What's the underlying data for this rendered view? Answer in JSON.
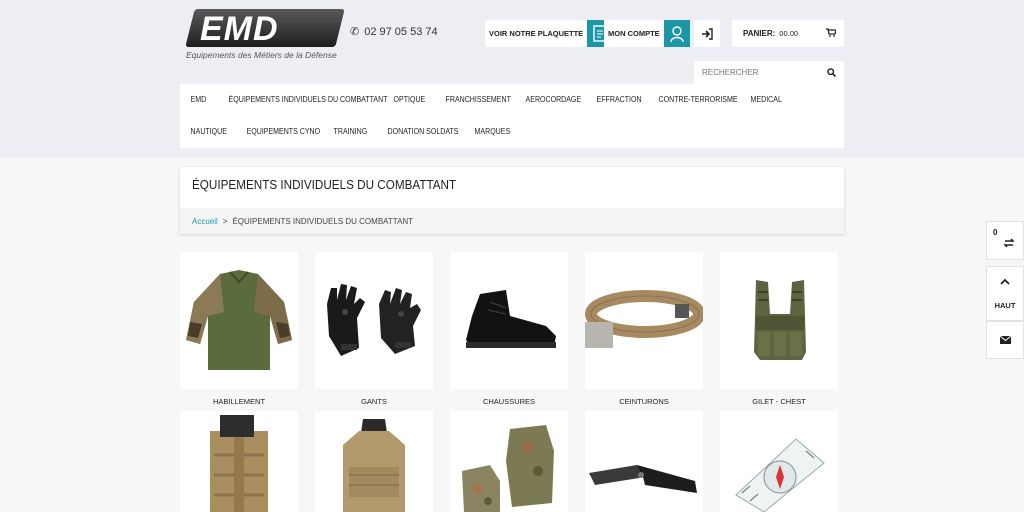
{
  "header": {
    "logo_text": "EMD",
    "tagline": "Equipements des Métiers de la Défense",
    "phone": "02 97 05 53 74",
    "plaquette_label": "VOIR NOTRE PLAQUETTE",
    "account_label": "MON COMPTE",
    "cart_label": "PANIER:",
    "cart_value": "00.00",
    "search_placeholder": "RECHERCHER"
  },
  "nav": {
    "row1": [
      "EMD",
      "ÉQUIPEMENTS INDIVIDUELS DU COMBATTANT",
      "OPTIQUE",
      "FRANCHISSEMENT",
      "AEROCORDAGE",
      "EFFRACTION",
      "CONTRE-TERRORISME",
      "MEDICAL"
    ],
    "row2": [
      "NAUTIQUE",
      "EQUIPEMENTS CYNO",
      "TRAINING",
      "DONATION SOLDATS",
      "MARQUES"
    ]
  },
  "page": {
    "title": "ÉQUIPEMENTS INDIVIDUELS DU COMBATTANT",
    "breadcrumb_home": "Accueil",
    "breadcrumb_sep": ">",
    "breadcrumb_current": "ÉQUIPEMENTS INDIVIDUELS DU COMBATTANT"
  },
  "categories": [
    "HABILLEMENT",
    "GANTS",
    "CHAUSSURES",
    "CEINTURONS",
    "GILET - CHEST",
    "",
    "",
    "",
    "",
    ""
  ],
  "sidebar": {
    "compare_count": "0",
    "top_label": "HAUT"
  },
  "colors": {
    "accent": "#1d97a8",
    "band": "#eceef3"
  }
}
